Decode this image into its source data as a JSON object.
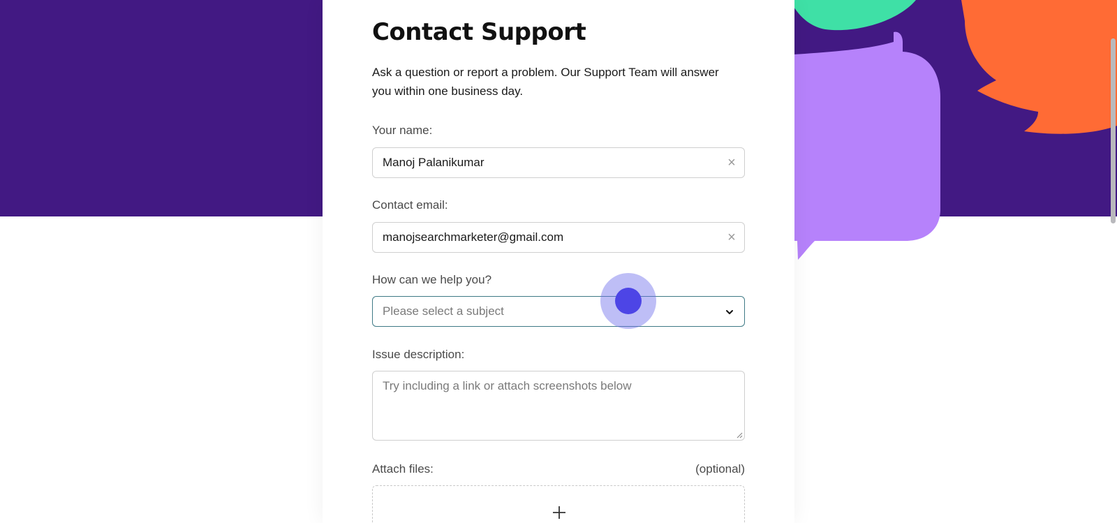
{
  "form": {
    "title": "Contact Support",
    "intro": "Ask a question or report a problem. Our Support Team will answer you within one business day.",
    "name": {
      "label": "Your name:",
      "value": "Manoj Palanikumar"
    },
    "email": {
      "label": "Contact email:",
      "value": "manojsearchmarketer@gmail.com"
    },
    "subject": {
      "label": "How can we help you?",
      "placeholder": "Please select a subject"
    },
    "description": {
      "label": "Issue description:",
      "placeholder": "Try including a link or attach screenshots below"
    },
    "attachments": {
      "label": "Attach files:",
      "optional_note": "(optional)"
    }
  },
  "icons": {
    "clear": "close-icon",
    "dropdown": "chevron-down-icon",
    "add_file": "plus-icon"
  },
  "colors": {
    "banner": "#421983",
    "accent_green": "#3fe0a6",
    "accent_lavender": "#b682fb",
    "accent_orange": "#ff6b35",
    "select_border": "#3f7a86",
    "cursor": "#4d45e6"
  }
}
